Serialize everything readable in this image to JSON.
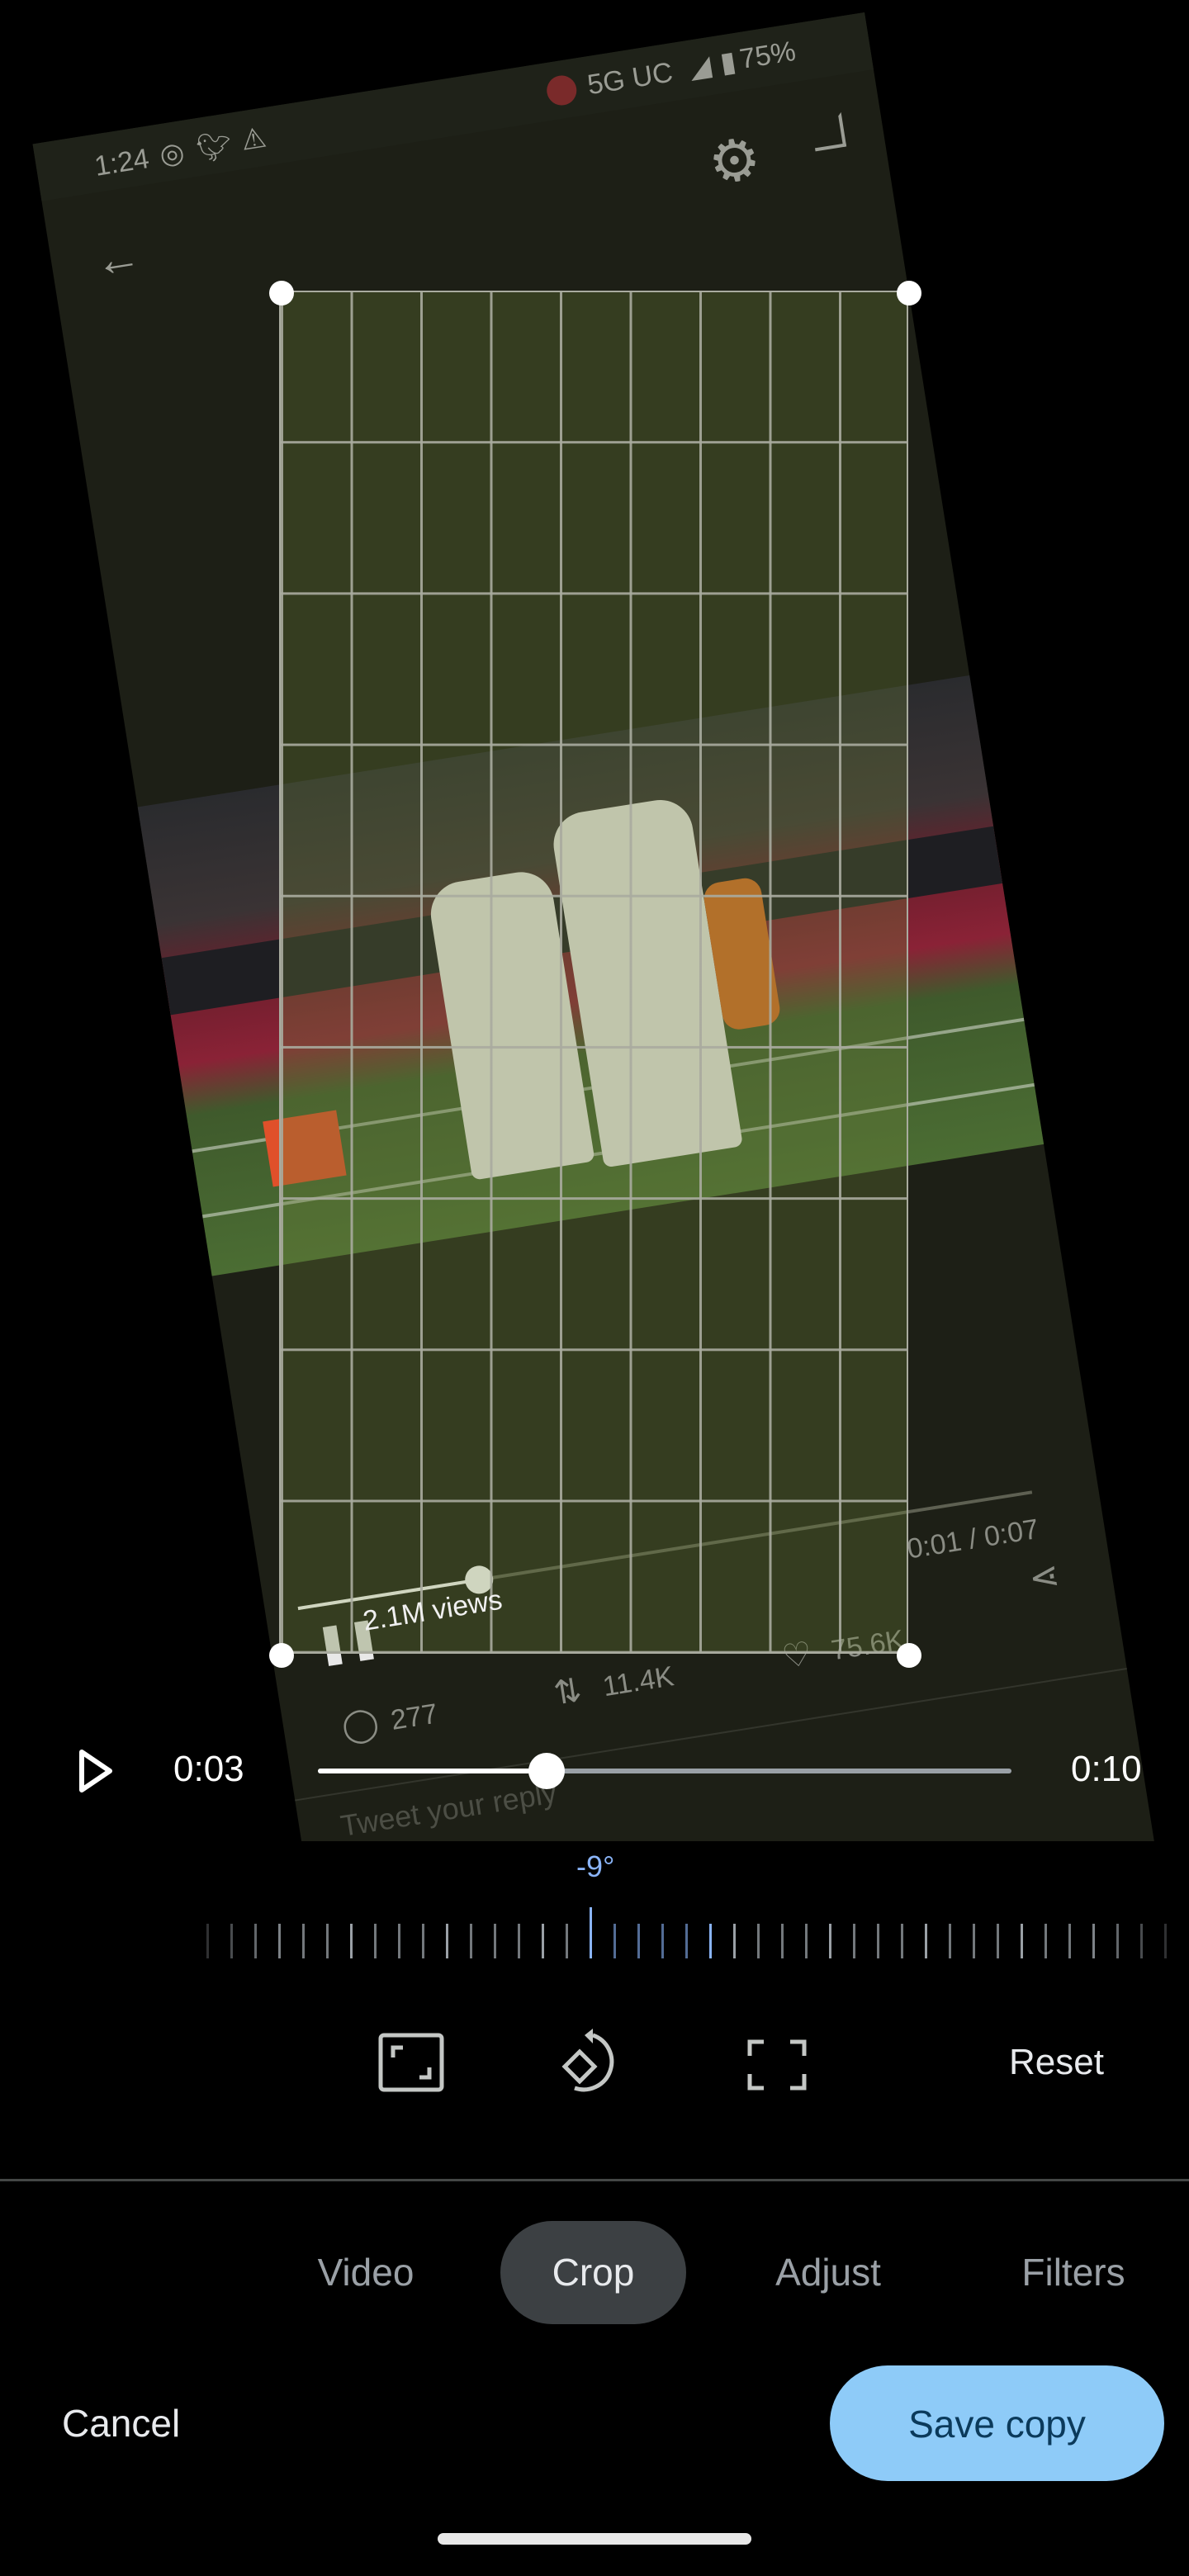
{
  "source_screen": {
    "status_bar": {
      "time": "1:24",
      "network": "5G UC",
      "battery": "75%"
    },
    "icons": [
      "screen-record-icon",
      "twitter-icon",
      "warning-icon",
      "gear-icon",
      "exit-icon",
      "back-arrow-icon"
    ],
    "video_progress": 0.14,
    "views": "2.1M views",
    "video_time": "0:01 / 0:07",
    "stats": {
      "replies": "277",
      "retweets": "11.4K",
      "likes": "75.6K"
    },
    "reply_placeholder": "Tweet your reply"
  },
  "player": {
    "current_time": "0:03",
    "duration": "0:10",
    "progress": 0.33
  },
  "straighten": {
    "angle_label": "-9°",
    "angle": -9,
    "accent_color": "#8ab4f8"
  },
  "tools": {
    "reset_label": "Reset",
    "icons": [
      "aspect-ratio-icon",
      "rotate-icon",
      "free-crop-icon"
    ]
  },
  "tabs": [
    {
      "label": "Video",
      "active": false
    },
    {
      "label": "Crop",
      "active": true
    },
    {
      "label": "Adjust",
      "active": false
    },
    {
      "label": "Filters",
      "active": false
    }
  ],
  "actions": {
    "cancel_label": "Cancel",
    "save_label": "Save copy",
    "save_color": "#8ecbf8"
  }
}
